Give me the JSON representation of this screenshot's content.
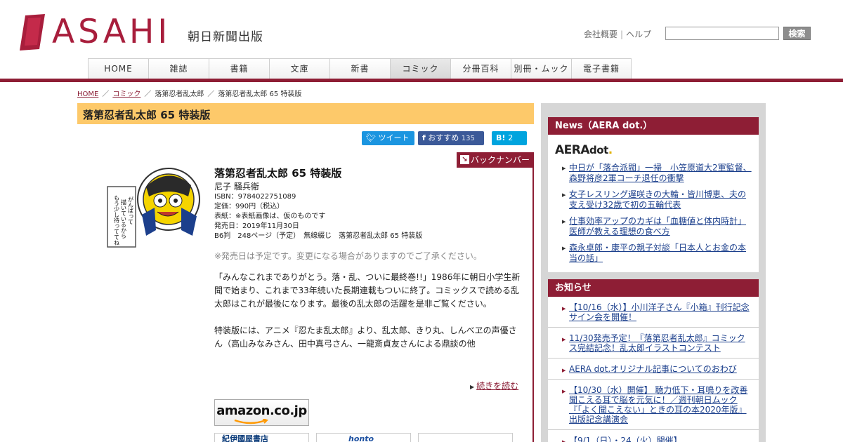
{
  "header": {
    "logo_text": "ASAHI",
    "logo_sub": "朝日新聞出版",
    "util_links": [
      "会社概要",
      "ヘルプ"
    ],
    "search_button": "検索",
    "search_value": ""
  },
  "nav": [
    {
      "label": "HOME"
    },
    {
      "label": "雑誌"
    },
    {
      "label": "書籍"
    },
    {
      "label": "文庫"
    },
    {
      "label": "新書"
    },
    {
      "label": "コミック",
      "active": true
    },
    {
      "label": "分冊百科"
    },
    {
      "label": "別冊・ムック"
    },
    {
      "label": "電子書籍"
    }
  ],
  "breadcrumb": [
    "HOME",
    "コミック",
    "落第忍者乱太郎",
    "落第忍者乱太郎 65 特装版"
  ],
  "page_title": "落第忍者乱太郎 65 特装版",
  "share": {
    "tweet": "ツイート",
    "fb_label": "おすすめ",
    "fb_count": "135",
    "hb_count": "2"
  },
  "backnumber": "バックナンバー",
  "cover_text": "がんばって描いているからもう少し待っててね",
  "book": {
    "title": "落第忍者乱太郎 65 特装版",
    "author": "尼子 騒兵衛",
    "isbn": "ISBN：9784022751089",
    "price": "定価：990円（税込）",
    "cover_note": "表紙：※表紙画像は、仮のものです",
    "release": "発売日：2019年11月30日",
    "format": "B6判　248ページ（予定）　無線綴じ　落第忍者乱太郎 65 特装版"
  },
  "notice": "※発売日は予定です。変更になる場合がありますのでご了承ください。",
  "description": [
    "「みんなこれまでありがとう。落・乱、ついに最終巻!!」1986年に朝日小学生新聞で始まり、これまで33年続いた長期連載もついに終了。コミックスで読める乱太郎はこれが最後になります。最後の乱太郎の活躍を是非ご覧ください。",
    "特装版には、アニメ『忍たま乱太郎』より、乱太郎、きり丸、しんべヱの声優さん（高山みなみさん、田中真弓さん、一龍斎貞友さんによる鼎談の他"
  ],
  "readmore": "続きを読む",
  "amazon": "amazon.co.jp",
  "stores": [
    "紀伊國屋書店",
    "honto",
    ""
  ],
  "sidebar": {
    "news_heading": "News（AERA dot.）",
    "aera_logo": "AERA",
    "aera_logo_sub": "dot",
    "news": [
      "中日が「落合派閥」一掃　小笠原道大2軍監督、森野将彦2軍コーチ退任の衝撃",
      "女子レスリング遅咲きの大輪・皆川博恵、夫の支え受け32歳で初の五輪代表",
      "仕事効率アップのカギは「血糖値と体内時計」医師が教える理想の食べ方",
      "森永卓郎・康平の親子対談「日本人とお金の本当の話」"
    ],
    "notice_heading": "お知らせ",
    "notices": [
      "【10/16（水）】小川洋子さん『小箱』刊行記念サイン会を開催！",
      "11/30発売予定！『落第忍者乱太郎』コミックス完結記念！乱太郎イラストコンテスト",
      "AERA dot.オリジナル記事についてのおわび",
      "【10/30（水）開催】 聴力低下・耳鳴りを改善 聞こえる耳で脳を元気に！／週刊朝日ムック『「よく聞こえない」ときの耳の本2020年版』出版記念講演会",
      "【9/1（日）・24（火）開催】…"
    ]
  },
  "colors": {
    "brand": "#8e1e35",
    "title_bar": "#fdc96a",
    "link": "#1b3f8c"
  }
}
